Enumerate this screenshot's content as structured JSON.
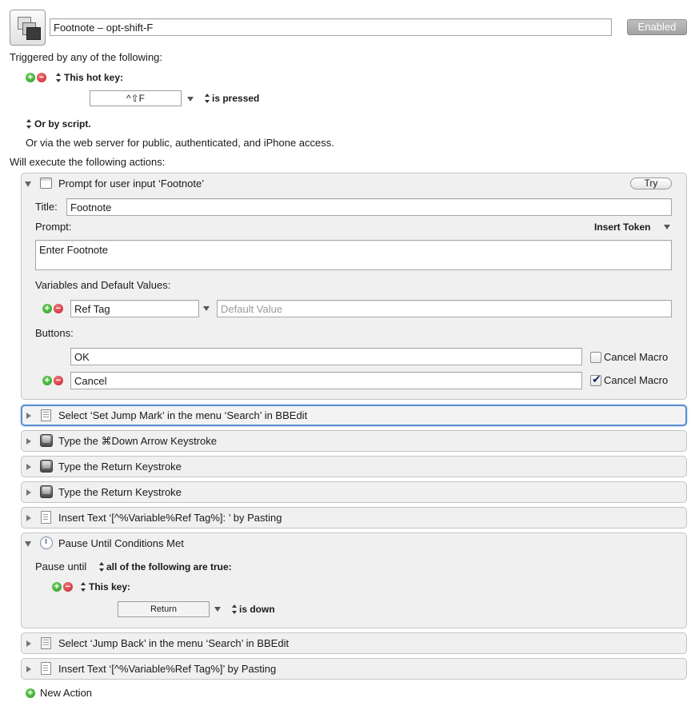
{
  "macro": {
    "name": "Footnote – opt-shift-F",
    "enabled_label": "Enabled"
  },
  "triggers": {
    "header": "Triggered by any of the following:",
    "hotkey_label": "This hot key:",
    "hotkey_value": "^⇧F",
    "hotkey_condition": "is pressed",
    "or_script": "Or by script.",
    "web_server": "Or via the web server for public, authenticated, and iPhone access."
  },
  "actions_header": "Will execute the following actions:",
  "prompt_action": {
    "title": "Prompt for user input ‘Footnote’",
    "try_label": "Try",
    "title_label": "Title:",
    "title_value": "Footnote",
    "prompt_label": "Prompt:",
    "insert_token": "Insert Token",
    "prompt_value": "Enter Footnote",
    "variables_label": "Variables and Default Values:",
    "variable_name": "Ref Tag",
    "default_value_placeholder": "Default Value",
    "buttons_label": "Buttons:",
    "buttons": [
      {
        "value": "OK",
        "cancel_label": "Cancel Macro",
        "checked": false
      },
      {
        "value": "Cancel",
        "cancel_label": "Cancel Macro",
        "checked": true
      }
    ]
  },
  "collapsed_actions": [
    {
      "label": "Select ‘Set Jump Mark’ in the menu ‘Search’ in BBEdit",
      "icon": "menu-icon"
    },
    {
      "label": "Type the ⌘Down Arrow Keystroke",
      "icon": "keystroke-icon"
    },
    {
      "label": "Type the Return Keystroke",
      "icon": "keystroke-icon"
    },
    {
      "label": "Type the Return Keystroke",
      "icon": "keystroke-icon"
    },
    {
      "label": "Insert Text ‘[^%Variable%Ref Tag%]: ’ by Pasting",
      "icon": "text-icon"
    }
  ],
  "pause_action": {
    "title": "Pause Until Conditions Met",
    "pause_until": "Pause until",
    "condition": "all of the following are true:",
    "this_key": "This key:",
    "key_value": "Return",
    "key_state": "is down"
  },
  "trailing_actions": [
    {
      "label": "Select ‘Jump Back’ in the menu ‘Search’ in BBEdit",
      "icon": "menu-icon"
    },
    {
      "label": "Insert Text ‘[^%Variable%Ref Tag%]’ by Pasting",
      "icon": "text-icon"
    }
  ],
  "new_action": "New Action"
}
